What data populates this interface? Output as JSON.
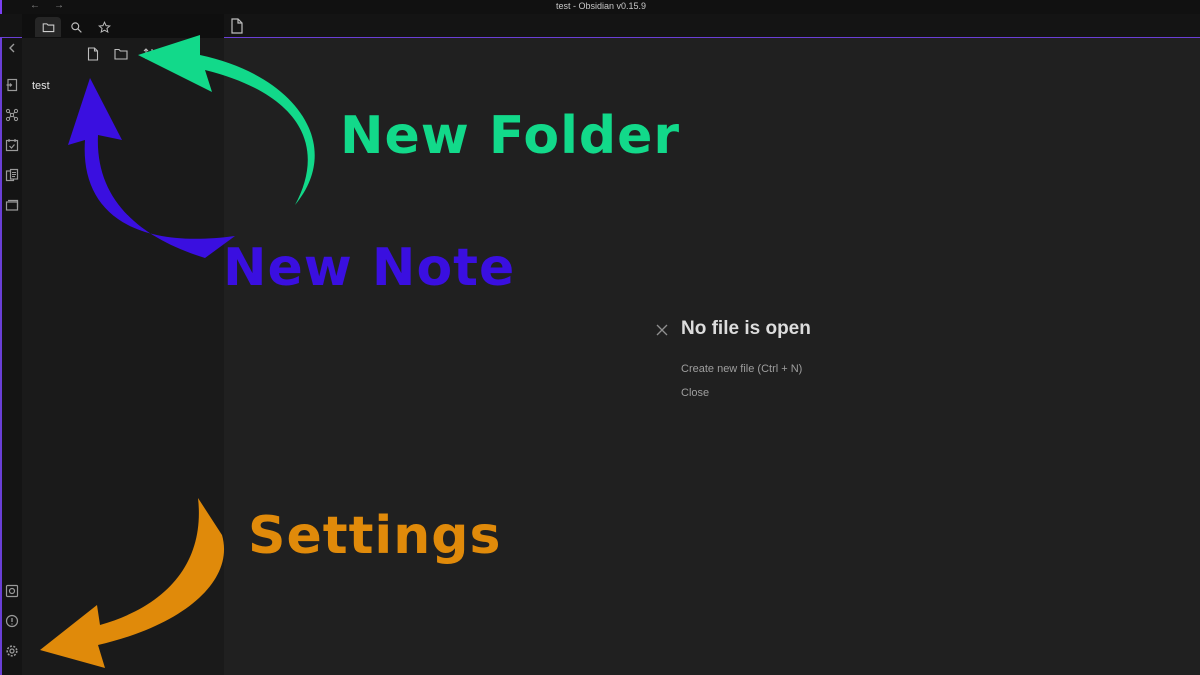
{
  "window": {
    "title": "test - Obsidian v0.15.9",
    "back_icon": "arrow-left-icon",
    "forward_icon": "arrow-right-icon"
  },
  "left_tabs": [
    {
      "name": "file-explorer",
      "icon": "folder-icon",
      "active": true
    },
    {
      "name": "search",
      "icon": "search-icon",
      "active": false
    },
    {
      "name": "starred",
      "icon": "star-icon",
      "active": false
    }
  ],
  "explorer": {
    "actions": [
      {
        "name": "new-note",
        "icon": "file-icon"
      },
      {
        "name": "new-folder",
        "icon": "folder-icon"
      },
      {
        "name": "sort",
        "icon": "sort-icon"
      }
    ],
    "files": [
      "test"
    ]
  },
  "ribbon": {
    "top": [
      "open-quick-switcher-icon",
      "graph-view-icon",
      "daily-note-icon",
      "templates-icon",
      "slides-icon"
    ],
    "bottom": [
      "open-vault-icon",
      "help-icon",
      "settings-icon"
    ]
  },
  "main": {
    "tab_icon": "file-icon",
    "empty_title": "No file is open",
    "actions": [
      "Create new file (Ctrl + N)",
      "Close"
    ]
  },
  "annotations": {
    "new_folder": "New Folder",
    "new_note": "New Note",
    "settings": "Settings",
    "colors": {
      "green": "#12d98a",
      "blue": "#3a0fe0",
      "orange": "#e08a0a"
    }
  }
}
